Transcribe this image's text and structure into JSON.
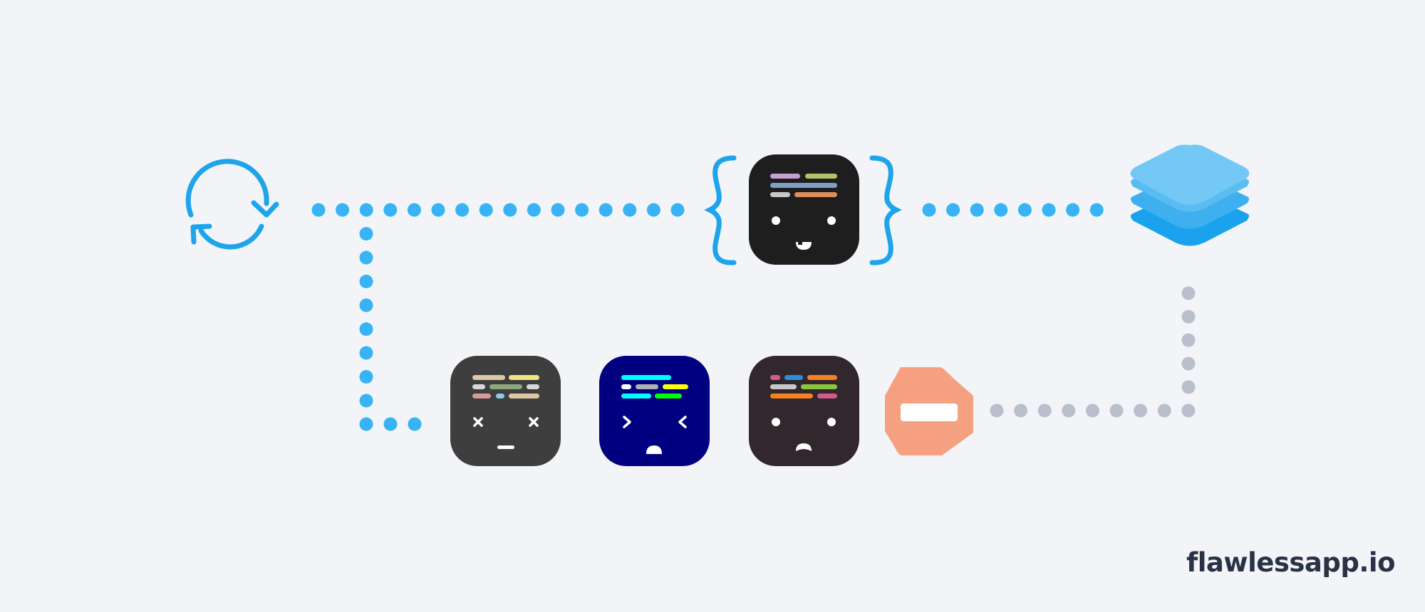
{
  "brand": {
    "text": "flawlessapp.io"
  },
  "colors": {
    "background": "#f2f4f8",
    "accent_blue": "#1ea4eb",
    "dot_blue": "#37b3f6",
    "dot_gray": "#b9bfcb",
    "stop_sign": "#f5a080",
    "brand_text": "#2a3346"
  },
  "nodes": [
    {
      "id": "sync",
      "icon": "sync-icon",
      "label": ""
    },
    {
      "id": "code-face-dark",
      "icon": "code-editor-face-icon",
      "theme": "dark",
      "mood": "smiling",
      "braces": true
    },
    {
      "id": "layers",
      "icon": "layers-stack-icon"
    },
    {
      "id": "code-face-gray",
      "icon": "code-editor-face-icon",
      "theme": "gray",
      "mood": "knocked-out"
    },
    {
      "id": "code-face-navy",
      "icon": "code-editor-face-icon",
      "theme": "navy",
      "mood": "squinting"
    },
    {
      "id": "code-face-plum",
      "icon": "code-editor-face-icon",
      "theme": "plum",
      "mood": "sad"
    },
    {
      "id": "stop",
      "icon": "stop-sign-icon"
    }
  ],
  "connections": [
    {
      "from": "sync",
      "to": "code-face-dark",
      "style": "dotted",
      "color": "blue"
    },
    {
      "from": "code-face-dark",
      "to": "layers",
      "style": "dotted",
      "color": "blue"
    },
    {
      "from": "sync",
      "to": "code-face-gray",
      "style": "dotted",
      "color": "blue"
    },
    {
      "from": "layers",
      "to": "stop",
      "style": "dotted",
      "color": "gray"
    }
  ]
}
